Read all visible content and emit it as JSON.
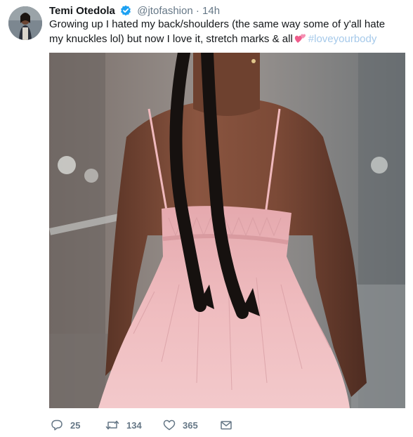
{
  "tweet": {
    "display_name": "Temi Otedola",
    "verified": true,
    "handle": "@jtofashion",
    "separator": "·",
    "time": "14h",
    "text": "Growing up I hated my back/shoulders (the same way some of y'all hate my knuckles lol) but now I love it, stretch marks & all",
    "emoji": "two-hearts-emoji",
    "hashtag": "#loveyourbody"
  },
  "media": {
    "description_icon": "photo"
  },
  "actions": {
    "reply": {
      "icon": "reply-icon",
      "count": "25"
    },
    "retweet": {
      "icon": "retweet-icon",
      "count": "134"
    },
    "like": {
      "icon": "heart-icon",
      "count": "365"
    },
    "dm": {
      "icon": "envelope-icon"
    }
  },
  "colors": {
    "verified_badge": "#1da1f2",
    "hashtag": "#a5c9ea",
    "secondary_text": "#657786",
    "dress_pink": "#eab2b6",
    "emoji_pink": "#ef5d8c"
  }
}
